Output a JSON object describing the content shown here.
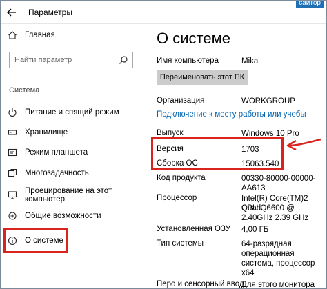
{
  "window": {
    "title": "Параметры",
    "top_right_text": "сайтор"
  },
  "sidebar": {
    "home_label": "Главная",
    "search_placeholder": "Найти параметр",
    "section_label": "Система",
    "items": [
      {
        "label": "Питание и спящий режим",
        "icon": "power-icon"
      },
      {
        "label": "Хранилище",
        "icon": "storage-icon"
      },
      {
        "label": "Режим планшета",
        "icon": "tablet-icon"
      },
      {
        "label": "Многозадачность",
        "icon": "multitask-icon"
      },
      {
        "label": "Проецирование на этот компьютер",
        "icon": "project-icon"
      },
      {
        "label": "Общие возможности",
        "icon": "shared-icon"
      },
      {
        "label": "О системе",
        "icon": "info-icon",
        "selected": true
      }
    ]
  },
  "content": {
    "title": "О системе",
    "pc_name_label": "Имя компьютера",
    "pc_name_value": "Mika",
    "rename_button": "Переименовать этот ПК",
    "org_label": "Организация",
    "org_value": "WORKGROUP",
    "connect_link": "Подключение к месту работы или учебы",
    "edition_label": "Выпуск",
    "edition_value": "Windows 10 Pro",
    "version_label": "Версия",
    "version_value": "1703",
    "build_label": "Сборка ОС",
    "build_value": "15063.540",
    "product_label": "Код продукта",
    "product_value_1": "00330-80000-00000-",
    "product_value_2": "AA613",
    "cpu_label": "Процессор",
    "cpu_value_1": "Intel(R) Core(TM)2 Quad",
    "cpu_value_2": "CPU    Q6600  @",
    "cpu_value_3": "2.40GHz   2.39 GHz",
    "ram_label": "Установленная ОЗУ",
    "ram_value": "4,00 ГБ",
    "systype_label": "Тип системы",
    "systype_value_1": "64-разрядная",
    "systype_value_2": "операционная",
    "systype_value_3": "система, процессор",
    "systype_value_4": "x64",
    "pen_label": "Перо и сенсорный ввод",
    "pen_value": "Для этого монитора"
  },
  "colors": {
    "highlight": "#d9241e",
    "link": "#0063b1",
    "button_bg": "#cccccc"
  }
}
